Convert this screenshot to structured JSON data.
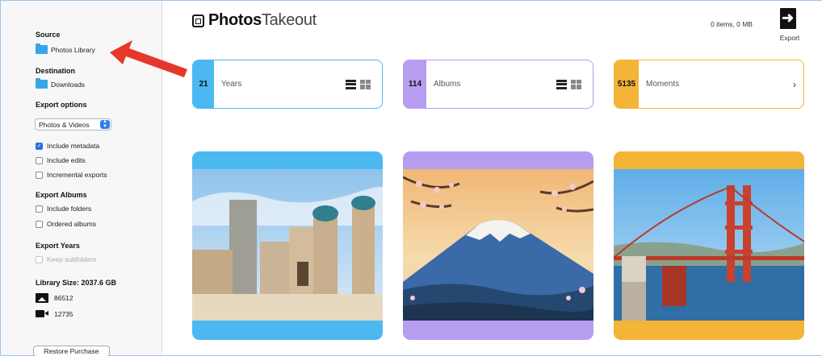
{
  "sidebar": {
    "source": {
      "title": "Source",
      "folder_label": "Photos Library"
    },
    "destination": {
      "title": "Destination",
      "folder_label": "Downloads"
    },
    "export_options": {
      "title": "Export options",
      "media_select": "Photos & Videos",
      "include_metadata": {
        "label": "Include metadata",
        "checked": true
      },
      "include_edits": {
        "label": "Include edits",
        "checked": false
      },
      "incremental_exports": {
        "label": "Incremental exports",
        "checked": false
      }
    },
    "export_albums": {
      "title": "Export Albums",
      "include_folders": {
        "label": "Include folders",
        "checked": false
      },
      "ordered_albums": {
        "label": "Ordered albums",
        "checked": false
      }
    },
    "export_years": {
      "title": "Export Years",
      "keep_subfolders": {
        "label": "Keep subfolders",
        "checked": false,
        "disabled": true
      }
    },
    "library": {
      "size_label": "Library Size: 2037.6 GB",
      "photos_count": "86512",
      "videos_count": "12735"
    },
    "restore_button": "Restore Purchase"
  },
  "header": {
    "logo_bold": "Photos",
    "logo_light": "Takeout",
    "items_status": "0 items, 0 MB",
    "export_label": "Export"
  },
  "categories": [
    {
      "count": "21",
      "label": "Years",
      "accent": "#4cb8f2"
    },
    {
      "count": "114",
      "label": "Albums",
      "accent": "#b79df0"
    },
    {
      "count": "5135",
      "label": "Moments",
      "accent": "#f3b437"
    }
  ],
  "photo_cards": [
    {
      "subject": "desert-fortress-towers",
      "accent": "#4cb8f2"
    },
    {
      "subject": "mount-fuji-cherry-blossoms",
      "accent": "#b79df0"
    },
    {
      "subject": "golden-gate-bridge",
      "accent": "#f3b437"
    }
  ],
  "annotation": {
    "color": "#e5372a",
    "target": "source-folder"
  }
}
